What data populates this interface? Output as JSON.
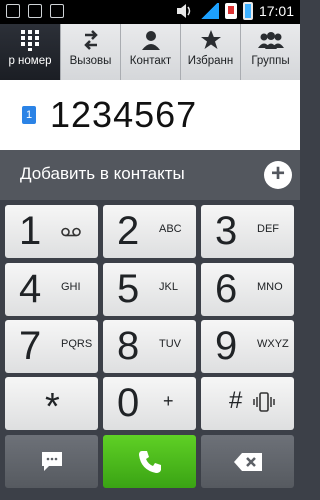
{
  "status_bar": {
    "time": "17:01",
    "notification_icons": [
      "screenshot-icon",
      "bag-icon",
      "image-icon"
    ],
    "status_icons": [
      "volume-icon",
      "signal-icon",
      "sim-card-icon",
      "battery-icon"
    ]
  },
  "tabs": [
    {
      "label": "р номер",
      "icon": "dialpad-icon",
      "active": true
    },
    {
      "label": "Вызовы",
      "icon": "call-log-icon",
      "active": false
    },
    {
      "label": "Контакт",
      "icon": "contact-icon",
      "active": false
    },
    {
      "label": "Избранн",
      "icon": "star-icon",
      "active": false
    },
    {
      "label": "Группы",
      "icon": "group-icon",
      "active": false
    }
  ],
  "display": {
    "sim_badge": "1",
    "number": "1234567"
  },
  "add_contact": {
    "label": "Добавить в контакты",
    "button_symbol": "+"
  },
  "keys": [
    {
      "digit": "1",
      "sub": "voicemail-icon"
    },
    {
      "digit": "2",
      "sub": "ABC"
    },
    {
      "digit": "3",
      "sub": "DEF"
    },
    {
      "digit": "4",
      "sub": "GHI"
    },
    {
      "digit": "5",
      "sub": "JKL"
    },
    {
      "digit": "6",
      "sub": "MNO"
    },
    {
      "digit": "7",
      "sub": "PQRS"
    },
    {
      "digit": "8",
      "sub": "TUV"
    },
    {
      "digit": "9",
      "sub": "WXYZ"
    },
    {
      "digit": "*",
      "sub": ""
    },
    {
      "digit": "0",
      "sub": "+"
    },
    {
      "digit": "#",
      "sub": "vibrate-icon"
    }
  ],
  "bottom_row": [
    "message-icon",
    "call-icon",
    "backspace-icon"
  ],
  "colors": {
    "call_button": "#4cc21c",
    "tab_active_bg": "#24272e",
    "add_bar_bg": "#53575e",
    "sim_badge": "#2b83e6"
  }
}
